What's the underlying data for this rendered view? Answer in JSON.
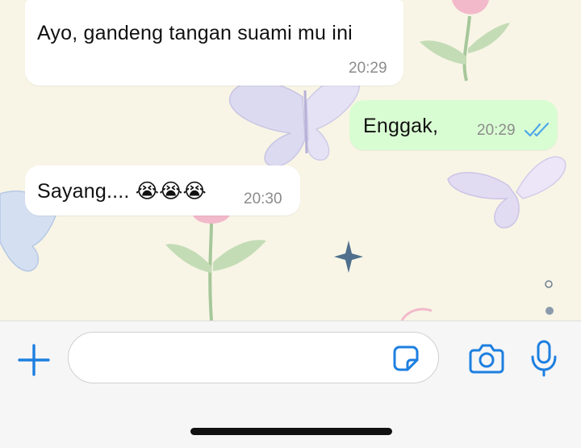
{
  "colors": {
    "accent": "#1d7fe0",
    "incoming_bubble": "#ffffff",
    "outgoing_bubble": "#d9fdd3",
    "read_ticks": "#4fa8e8",
    "wallpaper": "#f8f5e6"
  },
  "messages": [
    {
      "direction": "incoming",
      "text": "Ayo, gandeng tangan suami mu ini",
      "time": "20:29"
    },
    {
      "direction": "outgoing",
      "text": "Enggak,",
      "time": "20:29",
      "status": "read"
    },
    {
      "direction": "incoming",
      "text": "Sayang.... 😭😭😭",
      "time": "20:30"
    }
  ],
  "composer": {
    "input_value": "",
    "icons": {
      "attach": "plus-icon",
      "sticker": "sticker-icon",
      "camera": "camera-icon",
      "mic": "microphone-icon"
    }
  }
}
